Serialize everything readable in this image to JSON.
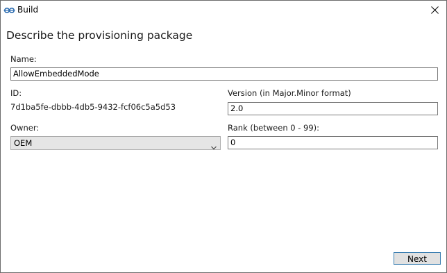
{
  "window": {
    "title": "Build"
  },
  "page": {
    "heading": "Describe the provisioning package"
  },
  "form": {
    "name_label": "Name:",
    "name_value": "AllowEmbeddedMode",
    "id_label": "ID:",
    "id_value": "7d1ba5fe-dbbb-4db5-9432-fcf06c5a5d53",
    "version_label": "Version (in Major.Minor format)",
    "version_value": "2.0",
    "owner_label": "Owner:",
    "owner_value": "OEM",
    "rank_label": "Rank (between 0 - 99):",
    "rank_value": "0"
  },
  "footer": {
    "next_label": "Next"
  },
  "icons": {
    "app": "build-gear-icon",
    "close": "close-icon",
    "dropdown": "chevron-down-icon"
  },
  "colors": {
    "accent_border": "#3c7fb1",
    "combo_bg": "#e5e5e5",
    "button_bg": "#e1e1e1"
  }
}
